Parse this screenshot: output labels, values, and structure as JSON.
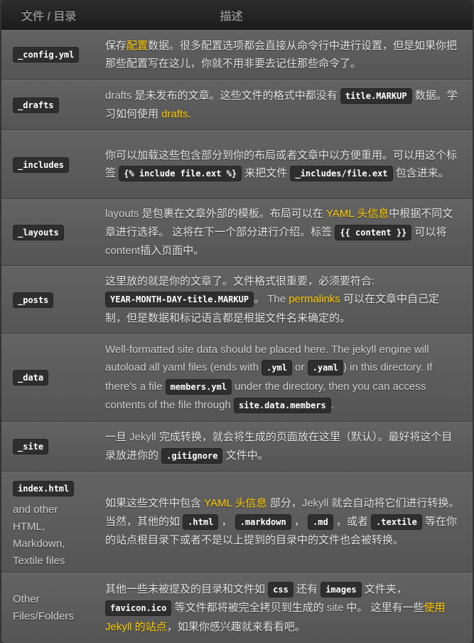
{
  "header": {
    "col_file": "文件 / 目录",
    "col_desc": "描述"
  },
  "colors": {
    "link": "#ffcc00",
    "header_bg": "#1c1c1c",
    "row_bg": "#5c5c5c",
    "code_bg": "#2e2e2e"
  },
  "rows": [
    {
      "file": "_config.yml",
      "desc": [
        {
          "t": "保存"
        },
        {
          "t": "配置",
          "link": true
        },
        {
          "t": "数据。很多配置选项都会直接从命令行中进行设置，但是如果你把那些配置写在这儿，你就不用非要去记住那些命令了。"
        }
      ]
    },
    {
      "file": "_drafts",
      "desc": [
        {
          "t": "drafts",
          "latin": true
        },
        {
          "t": " 是未发布的文章。这些文件的格式中都没有 "
        },
        {
          "t": "title.MARKUP",
          "code": true
        },
        {
          "t": " 数据。学习如何使用 "
        },
        {
          "t": "drafts.",
          "link": true
        }
      ]
    },
    {
      "file": "_includes",
      "desc": [
        {
          "t": "你可以加载这些包含部分到你的布局或者文章中以方便重用。可以用这个标签 "
        },
        {
          "t": "{% include file.ext %}",
          "code": true
        },
        {
          "t": " 来把文件 "
        },
        {
          "t": "_includes/file.ext",
          "code": true
        },
        {
          "t": " 包含进来。"
        }
      ]
    },
    {
      "file": "_layouts",
      "desc": [
        {
          "t": "layouts",
          "latin": true
        },
        {
          "t": " 是包裹在文章外部的模板。布局可以在 "
        },
        {
          "t": "YAML 头信息",
          "link": true
        },
        {
          "t": "中根据不同文章进行选择。 这将在下一个部分进行介绍。标签 "
        },
        {
          "t": "{{ content }}",
          "code": true
        },
        {
          "t": " 可以将"
        },
        {
          "t": "content",
          "latin": true
        },
        {
          "t": "插入页面中。"
        }
      ]
    },
    {
      "file": "_posts",
      "desc": [
        {
          "t": "这里放的就是你的文章了。文件格式很重要，必须要符合: "
        },
        {
          "t": "YEAR-MONTH-DAY-title.MARKUP",
          "code": true
        },
        {
          "t": "。 "
        },
        {
          "t": "The ",
          "latin": true
        },
        {
          "t": "permalinks",
          "link": true
        },
        {
          "t": " 可以在文章中自己定制，但是数据和标记语言都是根据文件名来确定的。"
        }
      ]
    },
    {
      "file": "_data",
      "desc": [
        {
          "t": "Well-formatted site data should be placed here. The jekyll engine will autoload all yaml files (ends with ",
          "latin": true
        },
        {
          "t": ".yml",
          "code": true
        },
        {
          "t": " or ",
          "latin": true
        },
        {
          "t": ".yaml",
          "code": true
        },
        {
          "t": ") in this directory. If there's a file ",
          "latin": true
        },
        {
          "t": "members.yml",
          "code": true
        },
        {
          "t": " under the directory, then you can access contents of the file through ",
          "latin": true
        },
        {
          "t": "site.data.members",
          "code": true
        },
        {
          "t": ".",
          "latin": true
        }
      ]
    },
    {
      "file": "_site",
      "desc": [
        {
          "t": "一旦 "
        },
        {
          "t": "Jekyll",
          "latin": true
        },
        {
          "t": " 完成转换，就会将生成的页面放在这里（默认）。最好将这个目录放进你的 "
        },
        {
          "t": ".gitignore",
          "code": true
        },
        {
          "t": " 文件中。"
        }
      ]
    },
    {
      "file": "index.html",
      "file_extra": "and other HTML, Markdown, Textile files",
      "desc": [
        {
          "t": "如果这些文件中包含 "
        },
        {
          "t": "YAML 头信息",
          "link": true
        },
        {
          "t": " 部分，"
        },
        {
          "t": "Jekyll",
          "latin": true
        },
        {
          "t": " 就会自动将它们进行转换。当然，其他的如 "
        },
        {
          "t": ".html",
          "code": true
        },
        {
          "t": " ， "
        },
        {
          "t": ".markdown",
          "code": true
        },
        {
          "t": " ， "
        },
        {
          "t": ".md",
          "code": true
        },
        {
          "t": " ，或者 "
        },
        {
          "t": ".textile",
          "code": true
        },
        {
          "t": " 等在你的站点根目录下或者不是以上提到的目录中的文件也会被转换。"
        }
      ]
    },
    {
      "file_text": "Other Files/Folders",
      "desc": [
        {
          "t": "其他一些未被提及的目录和文件如 "
        },
        {
          "t": "css",
          "code": true
        },
        {
          "t": " 还有 "
        },
        {
          "t": "images",
          "code": true
        },
        {
          "t": " 文件夹， "
        },
        {
          "t": "favicon.ico",
          "code": true
        },
        {
          "t": " 等文件都将被完全拷贝到生成的 "
        },
        {
          "t": "site",
          "latin": true
        },
        {
          "t": " 中。 这里有一些"
        },
        {
          "t": "使用 Jekyll 的站点",
          "link": true
        },
        {
          "t": "，如果你感兴趣就来看看吧。"
        }
      ]
    }
  ]
}
